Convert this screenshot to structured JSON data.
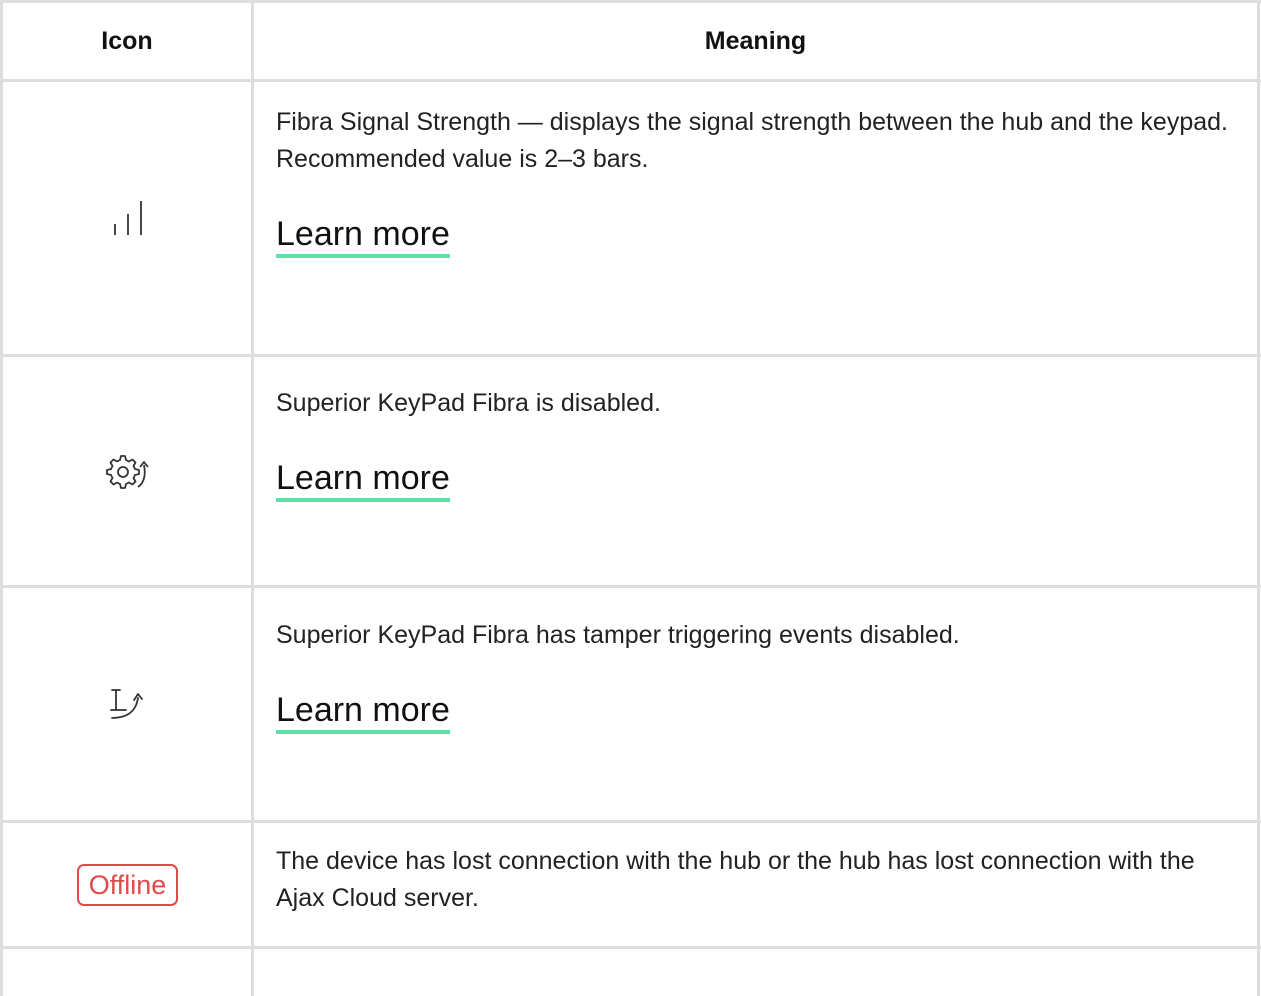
{
  "table": {
    "headers": {
      "icon": "Icon",
      "meaning": "Meaning"
    },
    "rows": [
      {
        "icon": "signal-strength-icon",
        "description": "Fibra Signal Strength — displays the signal strength between the hub and the keypad. Recommended value is 2–3 bars.",
        "link": "Learn more"
      },
      {
        "icon": "device-disabled-icon",
        "description": "Superior KeyPad Fibra is disabled.",
        "link": "Learn more"
      },
      {
        "icon": "tamper-disabled-icon",
        "description": "Superior KeyPad Fibra has tamper triggering events disabled.",
        "link": "Learn more"
      },
      {
        "badge": "Offline",
        "description": "The device has lost connection with the hub or the hub has lost connection with the Ajax Cloud server."
      }
    ]
  },
  "colors": {
    "border": "#dddddd",
    "link_underline": "#5ee0a8",
    "offline": "#e04a4a"
  }
}
